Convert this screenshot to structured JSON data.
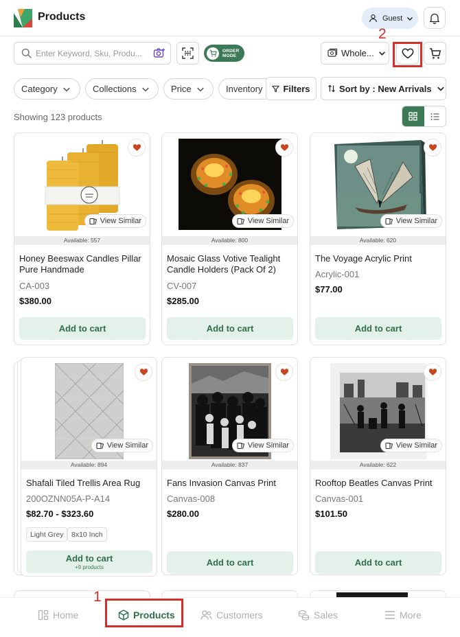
{
  "header": {
    "title": "Products",
    "user_label": "Guest"
  },
  "toolbar": {
    "search_placeholder": "Enter Keyword, Sku, Produ...",
    "order_mode_line1": "ORDER",
    "order_mode_line2": "MODE",
    "price_list_label": "Whole...",
    "annotation_wishlist_number": "2"
  },
  "filters": {
    "chips": [
      "Category",
      "Collections",
      "Price",
      "Inventory"
    ],
    "filters_label": "Filters",
    "sort_label": "Sort by : New Arrivals"
  },
  "results": {
    "count_text": "Showing 123 products"
  },
  "common": {
    "view_similar": "View Similar",
    "add_to_cart": "Add to cart"
  },
  "products": [
    {
      "name": "Honey Beeswax Candles Pillar Pure Handmade",
      "sku": "CA-003",
      "price": "$380.00",
      "available": "Available: 557"
    },
    {
      "name": "Mosaic Glass Votive Tealight Candle Holders (Pack Of 2)",
      "sku": "CV-007",
      "price": "$285.00",
      "available": "Available: 800"
    },
    {
      "name": "The Voyage Acrylic Print",
      "sku": "Acrylic-001",
      "price": "$77.00",
      "available": "Available: 620"
    },
    {
      "name": "Shafali Tiled Trellis Area Rug",
      "sku": "200OZNN05A-P-A14",
      "price": "$82.70 - $323.60",
      "available": "Available: 894",
      "tags": [
        "Light Grey",
        "8x10 Inch"
      ],
      "add_to_cart_sub": "+9 products"
    },
    {
      "name": "Fans Invasion Canvas Print",
      "sku": "Canvas-008",
      "price": "$280.00",
      "available": "Available: 837"
    },
    {
      "name": "Rooftop Beatles Canvas Print",
      "sku": "Canvas-001",
      "price": "$101.50",
      "available": "Available: 622"
    }
  ],
  "bottom_nav": {
    "items": [
      "Home",
      "Products",
      "Customers",
      "Sales",
      "More"
    ],
    "annotation_products_number": "1"
  },
  "colors": {
    "accent_green": "#3c7a57",
    "add_to_cart_bg": "#e4f1ea",
    "heart_fill": "#c8461f",
    "annotation_red": "#d3302b"
  }
}
